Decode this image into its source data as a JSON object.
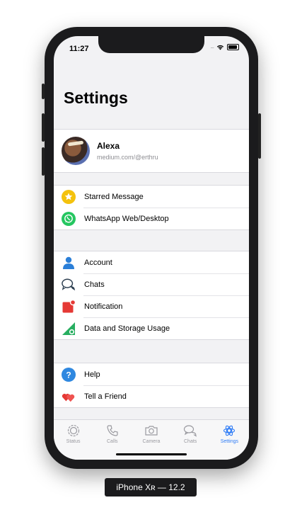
{
  "status_bar": {
    "time": "11:27",
    "signal": "....."
  },
  "page": {
    "title": "Settings"
  },
  "profile": {
    "name": "Alexa",
    "subtitle": "medium.com/@erthru"
  },
  "section1": [
    {
      "label": "Starred Message",
      "icon": "star-icon",
      "color": "#f4c20d"
    },
    {
      "label": "WhatsApp Web/Desktop",
      "icon": "whatsapp-icon",
      "color": "#25c660"
    }
  ],
  "section2": [
    {
      "label": "Account",
      "icon": "user-icon",
      "color": "#2b7fd8"
    },
    {
      "label": "Chats",
      "icon": "chat-bubbles-icon",
      "color": "#2c3e50"
    },
    {
      "label": "Notification",
      "icon": "notification-icon",
      "color": "#e53935"
    },
    {
      "label": "Data and Storage Usage",
      "icon": "data-storage-icon",
      "color": "#27ae60"
    }
  ],
  "section3": [
    {
      "label": "Help",
      "icon": "help-icon",
      "color": "#2f88e0"
    },
    {
      "label": "Tell a Friend",
      "icon": "hearts-icon",
      "color": "#e53935"
    }
  ],
  "tabbar": {
    "tabs": [
      {
        "label": "Status",
        "icon": "status-icon"
      },
      {
        "label": "Calls",
        "icon": "phone-icon"
      },
      {
        "label": "Camera",
        "icon": "camera-icon"
      },
      {
        "label": "Chats",
        "icon": "chats-icon"
      },
      {
        "label": "Settings",
        "icon": "gear-icon",
        "active": true
      }
    ],
    "active_color": "#2f7cf6"
  },
  "device_label": "iPhone Xʀ — 12.2"
}
